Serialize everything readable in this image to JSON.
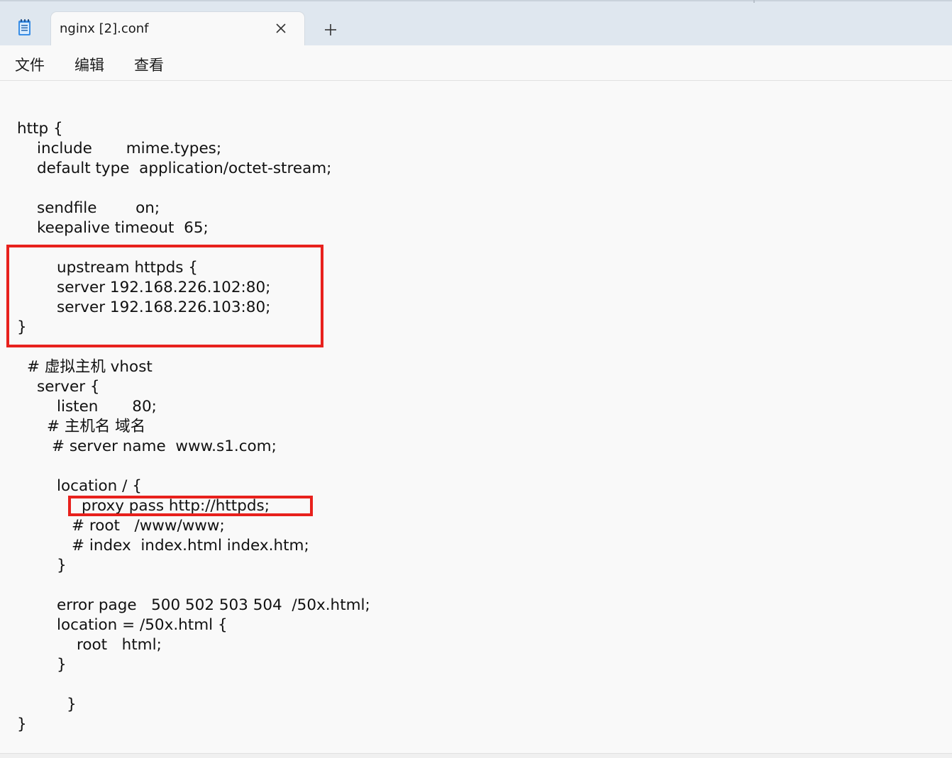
{
  "tab": {
    "title": "nginx [2].conf",
    "close_icon": "close-icon",
    "new_tab_icon": "plus-icon"
  },
  "app_icon": "notepad-icon",
  "menu": {
    "file": "文件",
    "edit": "编辑",
    "view": "查看"
  },
  "editor": {
    "lines": [
      "http {",
      "include       mime.types;",
      "default type  application/octet-stream;",
      "sendfile        on;",
      "keepalive timeout  65;",
      "upstream httpds {",
      "server 192.168.226.102:80;",
      "server 192.168.226.103:80;",
      "}",
      "# 虚拟主机 vhost",
      "server {",
      "listen       80;",
      "# 主机名 域名",
      "# server name  www.s1.com;",
      "location / {",
      "proxy pass http://httpds;",
      "# root   /www/www;",
      "# index  index.html index.htm;",
      "}",
      "error page   500 502 503 504  /50x.html;",
      "location = /50x.html {",
      "root   html;",
      "}",
      "}",
      "}"
    ]
  },
  "colors": {
    "tabbar_bg": "#dfe7ef",
    "editor_bg": "#f9f9f9",
    "highlight_border": "#e8211d",
    "text": "#111111"
  }
}
